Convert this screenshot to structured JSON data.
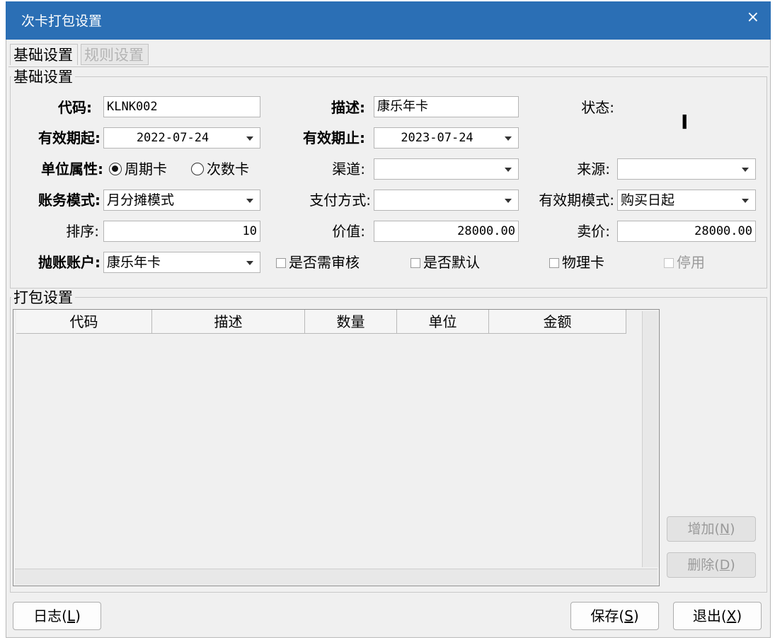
{
  "window": {
    "title": "次卡打包设置",
    "close_glyph": "×"
  },
  "tabs": [
    {
      "label": "基础设置",
      "active": true
    },
    {
      "label": "规则设置",
      "active": false
    }
  ],
  "basic_group": {
    "title": "基础设置",
    "code": {
      "label": "代码:",
      "value": "KLNK002"
    },
    "desc": {
      "label": "描述:",
      "value": "康乐年卡"
    },
    "status": {
      "label": "状态:",
      "value": "I"
    },
    "valid_from": {
      "label": "有效期起:",
      "value": "2022-07-24"
    },
    "valid_to": {
      "label": "有效期止:",
      "value": "2023-07-24"
    },
    "unit_attr": {
      "label": "单位属性:",
      "options": [
        "周期卡",
        "次数卡"
      ],
      "selected": "周期卡"
    },
    "channel": {
      "label": "渠道:",
      "value": ""
    },
    "source": {
      "label": "来源:",
      "value": ""
    },
    "account_mode": {
      "label": "账务模式:",
      "value": "月分摊模式"
    },
    "payment": {
      "label": "支付方式:",
      "value": ""
    },
    "validity_mode": {
      "label": "有效期模式:",
      "value": "购买日起"
    },
    "sort": {
      "label": "排序:",
      "value": "10"
    },
    "worth": {
      "label": "价值:",
      "value": "28000.00"
    },
    "price": {
      "label": "卖价:",
      "value": "28000.00"
    },
    "post_account": {
      "label": "抛账账户:",
      "value": "康乐年卡"
    },
    "checkboxes": [
      {
        "label": "是否需审核",
        "checked": false,
        "enabled": true
      },
      {
        "label": "是否默认",
        "checked": false,
        "enabled": true
      },
      {
        "label": "物理卡",
        "checked": false,
        "enabled": true
      },
      {
        "label": "停用",
        "checked": false,
        "enabled": false
      }
    ]
  },
  "package_group": {
    "title": "打包设置",
    "columns": [
      "代码",
      "描述",
      "数量",
      "单位",
      "金额"
    ],
    "rows": [],
    "add_button": {
      "label": "增加",
      "key": "N"
    },
    "delete_button": {
      "label": "删除",
      "key": "D"
    }
  },
  "footer": {
    "log_button": {
      "label": "日志",
      "key": "L"
    },
    "save_button": {
      "label": "保存",
      "key": "S"
    },
    "exit_button": {
      "label": "退出",
      "key": "X"
    }
  },
  "colors": {
    "titlebar": "#2b6fb5",
    "window_bg": "#f0f0f0"
  }
}
